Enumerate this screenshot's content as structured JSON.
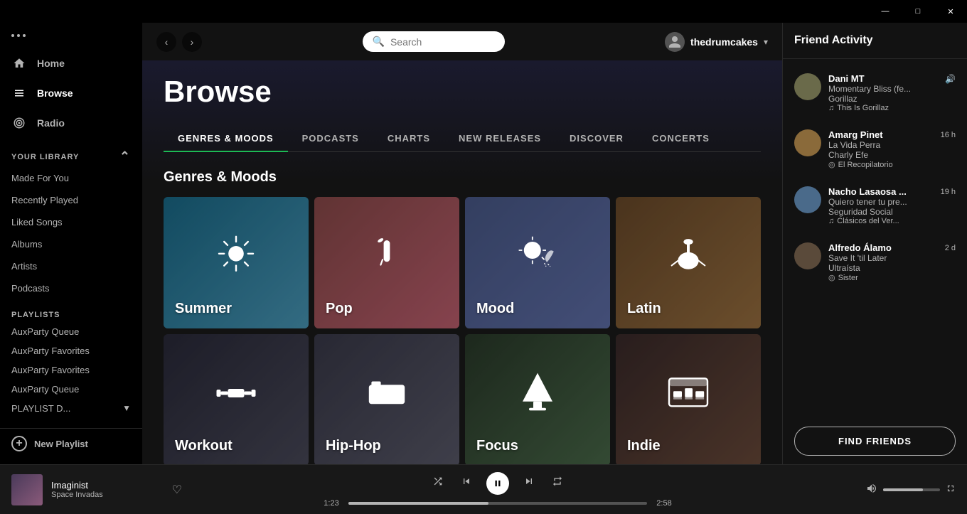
{
  "window": {
    "minimize": "—",
    "maximize": "□",
    "close": "✕"
  },
  "sidebar": {
    "menu_dots": "···",
    "nav": [
      {
        "id": "home",
        "label": "Home",
        "icon": "home"
      },
      {
        "id": "browse",
        "label": "Browse",
        "icon": "browse",
        "active": true
      },
      {
        "id": "radio",
        "label": "Radio",
        "icon": "radio"
      }
    ],
    "library_header": "YOUR LIBRARY",
    "library_items": [
      {
        "id": "made-for-you",
        "label": "Made For You"
      },
      {
        "id": "recently-played",
        "label": "Recently Played"
      },
      {
        "id": "liked-songs",
        "label": "Liked Songs"
      },
      {
        "id": "albums",
        "label": "Albums"
      },
      {
        "id": "artists",
        "label": "Artists"
      },
      {
        "id": "podcasts",
        "label": "Podcasts"
      }
    ],
    "playlists_header": "PLAYLISTS",
    "playlists": [
      {
        "id": "auxparty-queue-1",
        "label": "AuxParty Queue"
      },
      {
        "id": "auxparty-favorites-1",
        "label": "AuxParty Favorites"
      },
      {
        "id": "auxparty-favorites-2",
        "label": "AuxParty Favorites"
      },
      {
        "id": "auxparty-queue-2",
        "label": "AuxParty Queue"
      },
      {
        "id": "playlist-d",
        "label": "PLAYLIST D..."
      }
    ],
    "new_playlist": "New Playlist"
  },
  "topbar": {
    "search_placeholder": "Search",
    "username": "thedrumcakes"
  },
  "browse": {
    "title": "Browse",
    "tabs": [
      {
        "id": "genres-moods",
        "label": "GENRES & MOODS",
        "active": true
      },
      {
        "id": "podcasts",
        "label": "PODCASTS"
      },
      {
        "id": "charts",
        "label": "CHARTS"
      },
      {
        "id": "new-releases",
        "label": "NEW RELEASES"
      },
      {
        "id": "discover",
        "label": "DISCOVER"
      },
      {
        "id": "concerts",
        "label": "CONCERTS"
      }
    ],
    "section_title": "Genres & Moods",
    "genres": [
      {
        "id": "summer",
        "label": "Summer",
        "icon": "☀",
        "class": "card-summer"
      },
      {
        "id": "pop",
        "label": "Pop",
        "icon": "🎤",
        "class": "card-pop"
      },
      {
        "id": "mood",
        "label": "Mood",
        "icon": "⛅",
        "class": "card-mood"
      },
      {
        "id": "latin",
        "label": "Latin",
        "icon": "🎸",
        "class": "card-latin"
      },
      {
        "id": "workout",
        "label": "Workout",
        "icon": "🏋",
        "class": "card-workout"
      },
      {
        "id": "hiphop",
        "label": "Hip-Hop",
        "icon": "📻",
        "class": "card-hiphop"
      },
      {
        "id": "focus",
        "label": "Focus",
        "icon": "🏠",
        "class": "card-focus"
      },
      {
        "id": "indie",
        "label": "Indie",
        "icon": "📺",
        "class": "card-indie"
      }
    ]
  },
  "friend_activity": {
    "title": "Friend Activity",
    "friends": [
      {
        "id": "dani-mt",
        "name": "Dani MT",
        "song": "Momentary Bliss (fe...",
        "artist": "Gorillaz",
        "playlist": "This Is Gorillaz",
        "time": "",
        "playing": true,
        "avatar_color": "#6a6a4a"
      },
      {
        "id": "amarg-pinet",
        "name": "Amarg Pinet",
        "song": "La Vida Perra",
        "artist": "Charly Efe",
        "playlist": "El Recopilatorio",
        "time": "16 h",
        "playing": false,
        "avatar_color": "#8a6a3a"
      },
      {
        "id": "nacho-lasaosa",
        "name": "Nacho Lasaosa ...",
        "song": "Quiero tener tu pre...",
        "artist": "Seguridad Social",
        "playlist": "Clásicos del Ver...",
        "time": "19 h",
        "playing": false,
        "avatar_color": "#4a6a8a"
      },
      {
        "id": "alfredo-alamo",
        "name": "Alfredo Álamo",
        "song": "Save It 'til Later",
        "artist": "Ultraísta",
        "playlist": "Sister",
        "time": "2 d",
        "playing": false,
        "avatar_color": "#5a4a3a"
      }
    ],
    "find_friends_label": "FIND FRIENDS"
  },
  "player": {
    "track_name": "Imaginist",
    "track_artist": "Space Invadas",
    "current_time": "1:23",
    "total_time": "2:58",
    "progress_percent": 47,
    "shuffle_icon": "⇌",
    "prev_icon": "⏮",
    "play_icon": "⏸",
    "next_icon": "⏭",
    "repeat_icon": "↻",
    "volume_icon": "🔊",
    "volume_percent": 70,
    "fullscreen_icon": "⤢"
  }
}
